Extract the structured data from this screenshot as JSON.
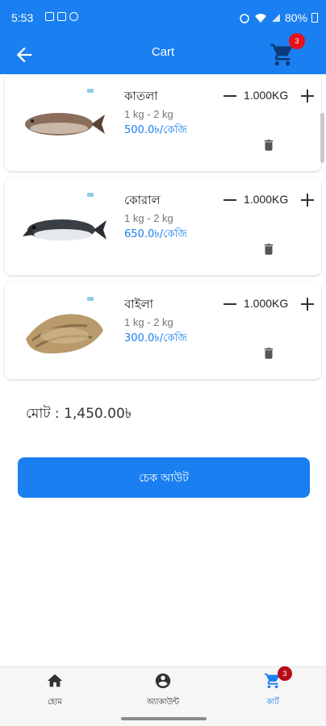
{
  "status_bar": {
    "time": "5:53",
    "battery": "80%"
  },
  "app_bar": {
    "title": "Cart",
    "cart_badge": "3"
  },
  "cart_items": [
    {
      "name": "কাতলা",
      "weight_range": "1 kg - 2 kg",
      "price": "500.0৳/কেজি",
      "quantity": "1.000KG"
    },
    {
      "name": "কোরাল",
      "weight_range": "1 kg - 2 kg",
      "price": "650.0৳/কেজি",
      "quantity": "1.000KG"
    },
    {
      "name": "বাইলা",
      "weight_range": "1 kg - 2 kg",
      "price": "300.0৳/কেজি",
      "quantity": "1.000KG"
    }
  ],
  "summary": {
    "total_text": "মোট : 1,450.00৳"
  },
  "checkout_button": {
    "label": "চেক আউট"
  },
  "bottom_nav": {
    "items": [
      {
        "label": "হোম",
        "icon": "home-icon"
      },
      {
        "label": "অ্যাকাউন্ট",
        "icon": "account-circle-icon"
      },
      {
        "label": "কার্ট",
        "icon": "cart-icon"
      }
    ],
    "cart_badge": "3"
  },
  "colors": {
    "primary": "#1a7ff0",
    "badge": "#e8101a",
    "price_text": "#1a7ff0"
  }
}
